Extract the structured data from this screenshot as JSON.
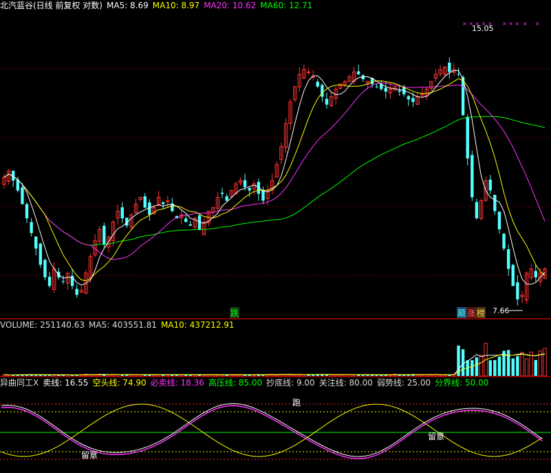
{
  "header": {
    "title": "北汽蓝谷(日线 前复权 对数)",
    "ma5": "MA5: 8.69",
    "ma10": "MA10: 8.97",
    "ma20": "MA20: 10.62",
    "ma60": "MA60: 12.71"
  },
  "volume_header": {
    "title": "VOLUME: 251140.63",
    "ma5": "MA5: 403551.81",
    "ma10": "MA10: 437212.91"
  },
  "indicator_header": {
    "title": "异曲同工X",
    "sell": "卖线: 16.55",
    "empty_head": "空头线: 74.90",
    "must_sell": "必卖线: 18.36",
    "high_pressure": "高压线: 85.00",
    "bottom": "抄底线: 9.00",
    "attention": "关注线: 80.00",
    "weak": "弱势线: 25.00",
    "divide": "分界线: 50.00"
  },
  "annotations": {
    "high_price": "15.05",
    "low_price": "7.66",
    "tag_fall": "跌",
    "tag_peak": "颠",
    "tag_rise": "涨",
    "tag_top": "榜",
    "run": "跑",
    "attention_left": "留意",
    "attention_right": "留意"
  },
  "colors": {
    "up": "#ff3232",
    "down": "#54ffff",
    "ma5": "#ffffff",
    "ma10": "#ffff00",
    "ma20": "#ff33ff",
    "ma60": "#00ff00",
    "grid": "#b40000"
  },
  "chart_data": [
    {
      "type": "candlestick",
      "title": "北汽蓝谷(日线 前复权 对数)",
      "scale": "log",
      "ylim": [
        7.4,
        17.5
      ],
      "series": [
        {
          "name": "MA5",
          "value": 8.69
        },
        {
          "name": "MA10",
          "value": 8.97
        },
        {
          "name": "MA20",
          "value": 10.62
        },
        {
          "name": "MA60",
          "value": 12.71
        }
      ],
      "close": [
        11.0,
        11.2,
        10.9,
        10.6,
        10.2,
        9.8,
        9.4,
        9.0,
        8.6,
        8.3,
        8.1,
        8.5,
        8.3,
        8.2,
        8.4,
        8.1,
        7.9,
        8.0,
        8.4,
        8.8,
        9.2,
        9.5,
        9.1,
        9.3,
        9.7,
        10.0,
        9.8,
        9.6,
        9.9,
        10.2,
        10.4,
        10.1,
        9.9,
        10.1,
        10.4,
        10.2,
        10.3,
        10.0,
        9.8,
        9.9,
        9.7,
        9.6,
        9.8,
        9.5,
        9.7,
        10.0,
        10.1,
        10.4,
        10.5,
        10.3,
        10.6,
        10.8,
        10.9,
        10.7,
        10.6,
        10.8,
        10.5,
        10.3,
        10.6,
        10.9,
        11.4,
        12.0,
        12.8,
        13.6,
        14.2,
        14.7,
        14.9,
        14.8,
        14.6,
        14.2,
        13.8,
        13.5,
        13.8,
        14.1,
        14.3,
        14.4,
        14.6,
        14.8,
        14.7,
        14.5,
        14.4,
        14.3,
        14.2,
        14.1,
        14.0,
        14.1,
        14.2,
        14.0,
        13.9,
        13.7,
        13.6,
        13.8,
        13.9,
        14.1,
        14.4,
        14.7,
        14.9,
        15.0,
        14.8,
        14.9,
        14.7,
        13.1,
        11.6,
        10.4,
        9.8,
        10.3,
        10.9,
        10.6,
        10.0,
        9.5,
        9.0,
        8.5,
        8.1,
        7.8,
        7.9,
        8.4,
        8.5,
        8.3,
        8.4,
        8.5
      ],
      "volume_ylim": [
        0,
        1150000
      ]
    },
    {
      "type": "line",
      "title": "异曲同工X",
      "ylim": [
        0,
        100
      ],
      "series": [
        {
          "name": "卖线",
          "value": 16.55
        },
        {
          "name": "空头线",
          "value": 74.9
        },
        {
          "name": "必卖线",
          "value": 18.36
        },
        {
          "name": "高压线",
          "value": 85.0
        },
        {
          "name": "抄底线",
          "value": 9.0
        },
        {
          "name": "关注线",
          "value": 80.0
        },
        {
          "name": "弱势线",
          "value": 25.0
        },
        {
          "name": "分界线",
          "value": 50.0
        }
      ]
    }
  ]
}
